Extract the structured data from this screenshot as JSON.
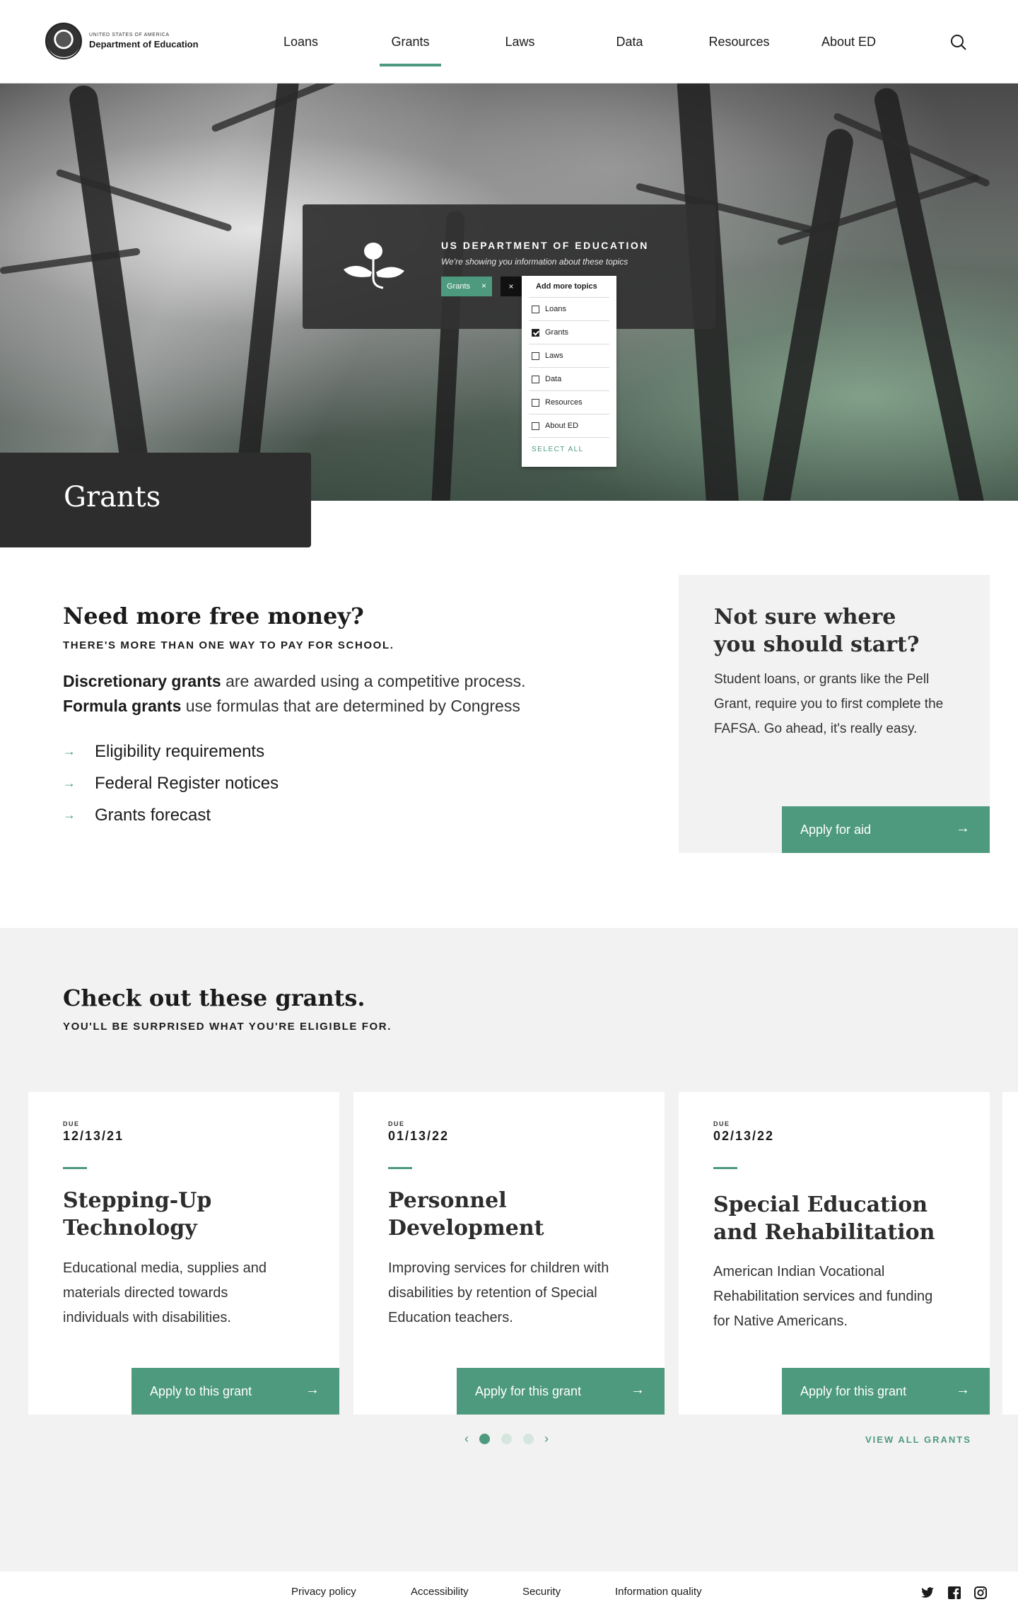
{
  "header": {
    "agency_line": "UNITED STATES OF AMERICA",
    "agency_name": "Department of Education",
    "nav": [
      "Loans",
      "Grants",
      "Laws",
      "Data",
      "Resources",
      "About ED"
    ],
    "active_nav": "Grants"
  },
  "hero": {
    "panel_title": "US DEPARTMENT OF EDUCATION",
    "panel_subtitle": "We're showing you information about these topics",
    "chip_label": "Grants",
    "chip_remove": "×",
    "clear_label": "×",
    "dropdown": {
      "heading": "Add more topics",
      "items": [
        {
          "label": "Loans",
          "checked": false
        },
        {
          "label": "Grants",
          "checked": true
        },
        {
          "label": "Laws",
          "checked": false
        },
        {
          "label": "Data",
          "checked": false
        },
        {
          "label": "Resources",
          "checked": false
        },
        {
          "label": "About ED",
          "checked": false
        }
      ],
      "select_all": "SELECT ALL"
    },
    "page_title": "Grants"
  },
  "intro": {
    "heading": "Need more free money?",
    "kicker": "THERE'S MORE THAN ONE WAY TO PAY FOR SCHOOL.",
    "p1_bold": "Discretionary grants",
    "p1_rest": " are awarded using a competitive process.",
    "p2_bold": "Formula grants",
    "p2_rest": " use formulas that are determined by Congress",
    "links": [
      "Eligibility requirements",
      "Federal Register notices",
      "Grants forecast"
    ],
    "link_arrow": "→"
  },
  "aside": {
    "heading": "Not sure where you should start?",
    "body": "Student loans, or grants like the Pell Grant, require you to first complete the FAFSA. Go ahead, it's really easy.",
    "button": "Apply for aid",
    "arrow": "→"
  },
  "grants": {
    "heading": "Check out these grants.",
    "kicker": "YOU'LL BE SURPRISED WHAT YOU'RE ELIGIBLE FOR.",
    "due_label": "DUE",
    "cards": [
      {
        "due": "12/13/21",
        "title": "Stepping-Up Technology",
        "body": "Educational media, supplies and materials directed towards individuals with disabilities.",
        "button": "Apply to this grant"
      },
      {
        "due": "01/13/22",
        "title": "Personnel Development",
        "body": "Improving services for children with disabilities by retention of Special Education teachers.",
        "button": "Apply for this grant"
      },
      {
        "due": "02/13/22",
        "title": "Special Education and Rehabilitation",
        "body": "American Indian Vocational Rehabilitation services and funding for Native Americans.",
        "button": "Apply for this grant"
      }
    ],
    "arrow": "→",
    "prev": "‹",
    "next": "›",
    "pages": 3,
    "current_page": 1,
    "view_all": "VIEW ALL GRANTS"
  },
  "footer": {
    "links": [
      "Privacy policy",
      "Accessibility",
      "Security",
      "Information quality"
    ],
    "social": [
      "twitter-icon",
      "facebook-icon",
      "instagram-icon"
    ]
  },
  "colors": {
    "accent": "#4e9a7e",
    "dark_panel": "#2d2d2d",
    "light_bg": "#f2f2f2"
  }
}
